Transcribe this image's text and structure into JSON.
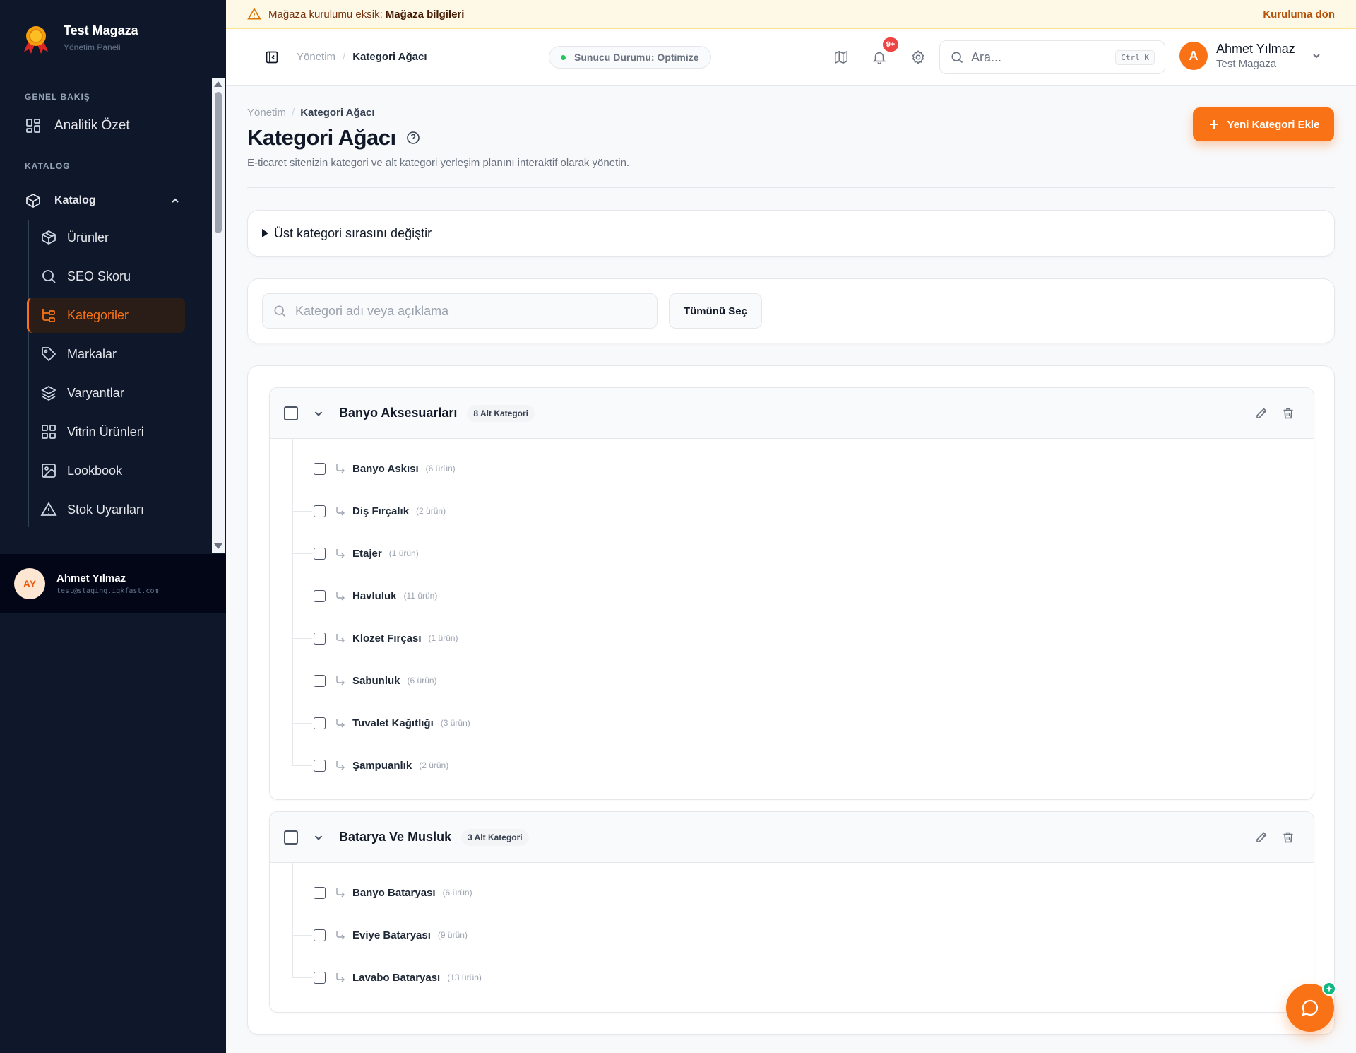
{
  "brand": {
    "title": "Test Magaza",
    "subtitle": "Yönetim Paneli"
  },
  "sidebar": {
    "section_overview": "GENEL BAKIŞ",
    "overview_item": "Analitik Özet",
    "section_catalog": "KATALOG",
    "catalog_parent": "Katalog",
    "items": [
      {
        "label": "Ürünler",
        "icon": "box-icon",
        "active": false
      },
      {
        "label": "SEO Skoru",
        "icon": "search-icon",
        "active": false
      },
      {
        "label": "Kategoriler",
        "icon": "tree-icon",
        "active": true
      },
      {
        "label": "Markalar",
        "icon": "tag-icon",
        "active": false
      },
      {
        "label": "Varyantlar",
        "icon": "layers-icon",
        "active": false
      },
      {
        "label": "Vitrin Ürünleri",
        "icon": "grid-icon",
        "active": false
      },
      {
        "label": "Lookbook",
        "icon": "gallery-icon",
        "active": false
      },
      {
        "label": "Stok Uyarıları",
        "icon": "warning-icon",
        "active": false
      }
    ],
    "user": {
      "initials": "AY",
      "name": "Ahmet Yılmaz",
      "email": "test@staging.igkfast.com"
    }
  },
  "banner": {
    "text": "Mağaza kurulumu eksik:",
    "link": "Mağaza bilgileri",
    "action": "Kuruluma dön"
  },
  "header": {
    "crumb_root": "Yönetim",
    "crumb_current": "Kategori Ağacı",
    "status": "Sunucu Durumu: Optimize",
    "notif_count": "9+",
    "search_placeholder": "Ara...",
    "search_kbd": "Ctrl K",
    "user_initial": "A",
    "user_name": "Ahmet Yılmaz",
    "user_store": "Test Magaza"
  },
  "page": {
    "crumb_root": "Yönetim",
    "crumb_current": "Kategori Ağacı",
    "title": "Kategori Ağacı",
    "description": "E-ticaret sitenizin kategori ve alt kategori yerleşim planını interaktif olarak yönetin.",
    "add_button": "Yeni Kategori Ekle",
    "details_label": "Üst kategori sırasını değiştir",
    "filter_placeholder": "Kategori adı veya açıklama",
    "select_all": "Tümünü Seç"
  },
  "groups": [
    {
      "name": "Banyo Aksesuarları",
      "badge": "8 Alt Kategori",
      "children": [
        {
          "name": "Banyo Askısı",
          "count": "(6 ürün)"
        },
        {
          "name": "Diş Fırçalık",
          "count": "(2 ürün)"
        },
        {
          "name": "Etajer",
          "count": "(1 ürün)"
        },
        {
          "name": "Havluluk",
          "count": "(11 ürün)"
        },
        {
          "name": "Klozet Fırçası",
          "count": "(1 ürün)"
        },
        {
          "name": "Sabunluk",
          "count": "(6 ürün)"
        },
        {
          "name": "Tuvalet Kağıtlığı",
          "count": "(3 ürün)"
        },
        {
          "name": "Şampuanlık",
          "count": "(2 ürün)"
        }
      ]
    },
    {
      "name": "Batarya Ve Musluk",
      "badge": "3 Alt Kategori",
      "children": [
        {
          "name": "Banyo Bataryası",
          "count": "(6 ürün)"
        },
        {
          "name": "Eviye Bataryası",
          "count": "(9 ürün)"
        },
        {
          "name": "Lavabo Bataryası",
          "count": "(13 ürün)"
        }
      ]
    }
  ],
  "colors": {
    "accent": "#f97316",
    "sidebar_bg": "#0f172a",
    "status_ok": "#22c55e",
    "badge_red": "#ef4444"
  }
}
